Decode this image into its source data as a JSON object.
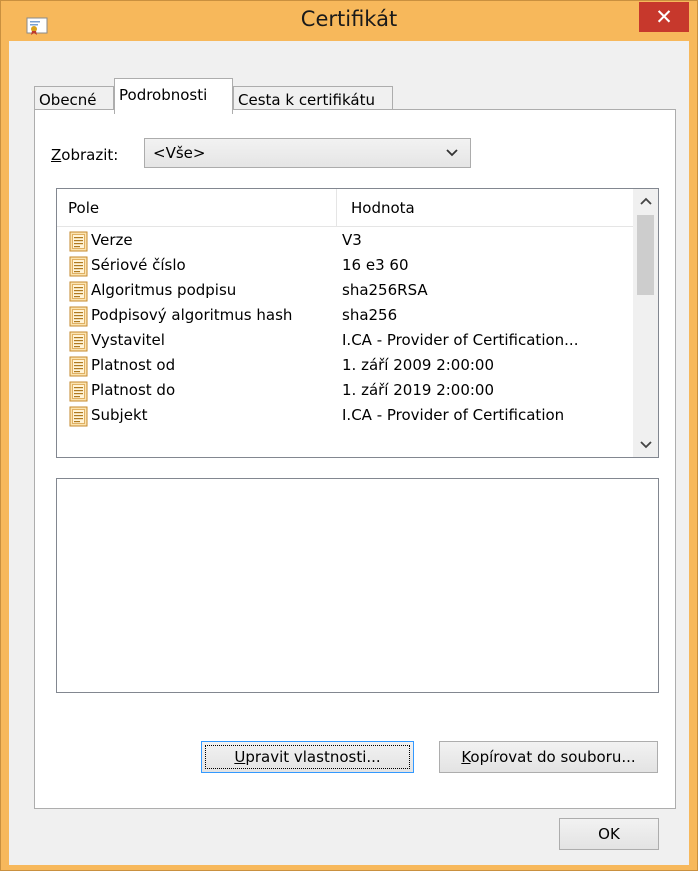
{
  "window": {
    "title": "Certifikát",
    "title_icon": "certificate-icon",
    "close_symbol": "✕",
    "accent_color": "#f7b85b",
    "close_color": "#c7382c"
  },
  "tabs": [
    {
      "label": "Obecné",
      "active": false
    },
    {
      "label": "Podrobnosti",
      "active": true
    },
    {
      "label": "Cesta k certifikátu",
      "active": false
    }
  ],
  "show": {
    "label_first": "Z",
    "label_rest": "obrazit:",
    "selected": "<Vše>",
    "arrow_icon": "chevron-down-icon"
  },
  "list": {
    "columns": [
      "Pole",
      "Hodnota"
    ],
    "rows": [
      {
        "field": "Verze",
        "value": "V3"
      },
      {
        "field": "Sériové číslo",
        "value": "16 e3 60"
      },
      {
        "field": "Algoritmus podpisu",
        "value": "sha256RSA"
      },
      {
        "field": "Podpisový algoritmus hash",
        "value": "sha256"
      },
      {
        "field": "Vystavitel",
        "value": "I.CA - Provider of Certification..."
      },
      {
        "field": "Platnost od",
        "value": "1. září 2009 2:00:00"
      },
      {
        "field": "Platnost do",
        "value": "1. září 2019 2:00:00"
      },
      {
        "field": "Subjekt",
        "value": "I.CA - Provider of Certification"
      }
    ],
    "row_icon": "certificate-field-icon",
    "scroll_up_icon": "chevron-up-icon",
    "scroll_down_icon": "chevron-down-icon"
  },
  "detail_value": "",
  "buttons": {
    "edit_first": "U",
    "edit_rest": "pravit vlastnosti...",
    "copy_first": "K",
    "copy_rest": "opírovat do souboru...",
    "ok": "OK"
  }
}
